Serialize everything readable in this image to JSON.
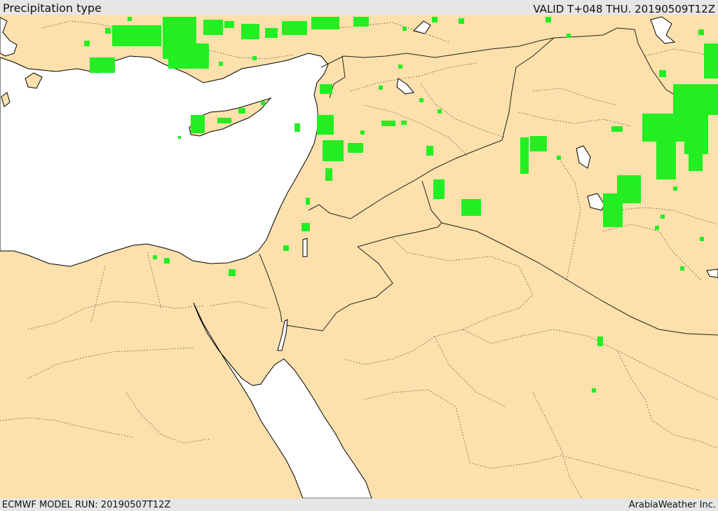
{
  "header": {
    "title": "Precipitation type",
    "valid": "VALID T+048 THU. 20190509T12Z"
  },
  "footer": {
    "model_run": "ECMWF MODEL RUN: 20190507T12Z",
    "credit": "ArabiaWeather Inc."
  },
  "map": {
    "land_color": "#fde0ab",
    "sea_color": "#ffffff",
    "rain_color": "#22ee22",
    "region": "Eastern Mediterranean, Levant, Iraq, Northern Saudi Arabia, Egypt"
  }
}
